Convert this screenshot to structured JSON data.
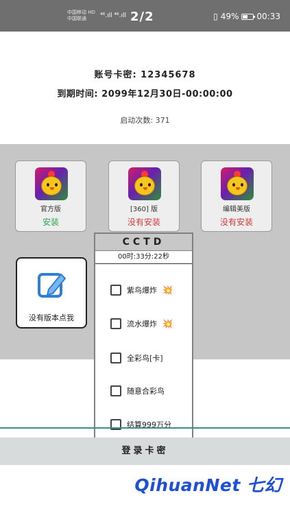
{
  "status_bar": {
    "carrier_1": "中国移动 HD",
    "carrier_2": "中国联通",
    "signal": "⁴⁶.ıll ⁴⁶.ıll",
    "page_indicator": "2/2",
    "vibrate": "▯",
    "battery": "49%",
    "time": "00:33"
  },
  "info": {
    "account": "账号卡密: 12345678",
    "expiry": "到期时间: 2099年12月30日-00:00:00",
    "launch_count": "启动次数: 371"
  },
  "versions": [
    {
      "name": "官方版",
      "status": "安装",
      "status_color": "#2ea44f"
    },
    {
      "name": "[360] 版",
      "status": "没有安装",
      "status_color": "#d03a3a"
    },
    {
      "name": "编辑美版",
      "status": "没有安装",
      "status_color": "#d03a3a"
    }
  ],
  "manual_button": {
    "label": "没有版本点我",
    "icon": "edit-icon"
  },
  "popup": {
    "title": "CCTD",
    "timer": "00时:33分:22秒",
    "options": [
      {
        "label": "紫鸟爆炸",
        "icon": "💥",
        "checked": false
      },
      {
        "label": "流水爆炸",
        "icon": "💥",
        "checked": false
      },
      {
        "label": "全彩鸟[卡]",
        "icon": "",
        "checked": false
      },
      {
        "label": "随意合彩鸟",
        "icon": "",
        "checked": false
      },
      {
        "label": "结算999万分",
        "icon": "",
        "checked": false
      }
    ]
  },
  "login_button": "登录卡密",
  "brand": "QihuanNet 七幻"
}
